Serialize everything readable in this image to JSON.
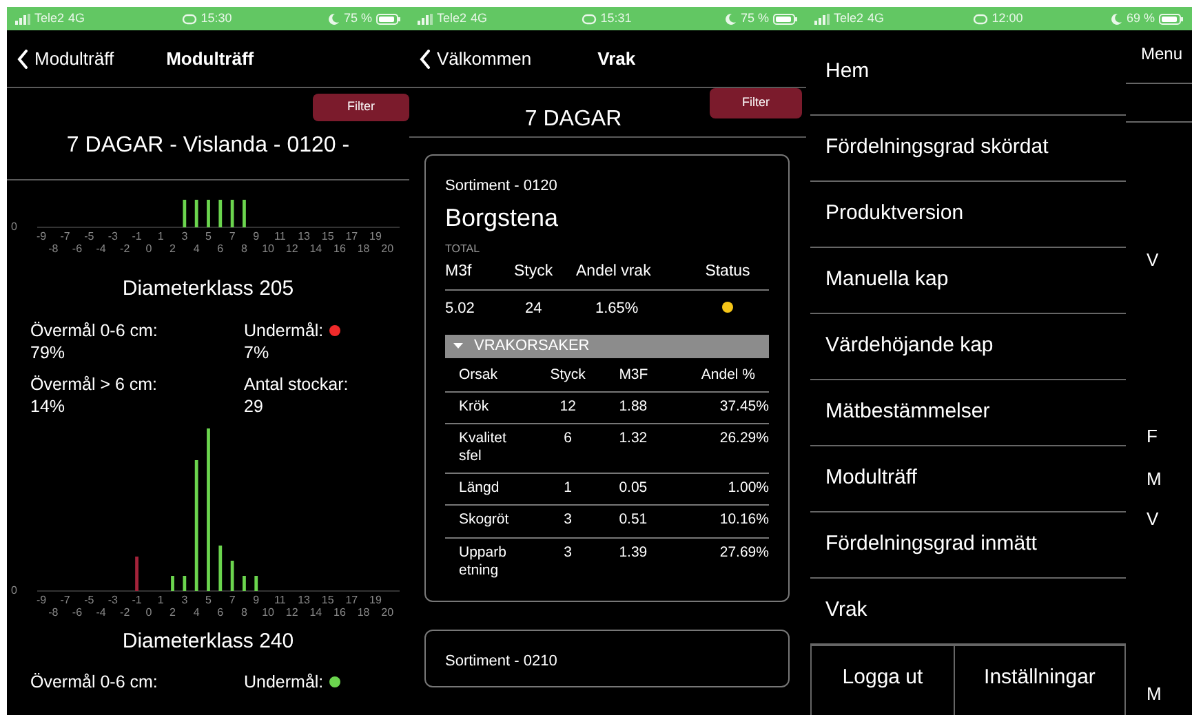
{
  "modultraff_screen": {
    "status_bar": {
      "carrier": "Tele2",
      "network": "4G",
      "time": "15:30",
      "battery": "75 %"
    },
    "nav": {
      "back": "Modulträff",
      "title": "Modulträff"
    },
    "filter_button": "Filter",
    "heading": "7 DAGAR - Vislanda - 0120 -",
    "classes": [
      {
        "chart": {
          "zero_label": "0",
          "x_labels": [
            "-9",
            "-8",
            "-7",
            "-6",
            "-5",
            "-4",
            "-3",
            "-2",
            "-1",
            "0",
            "1",
            "2",
            "3",
            "4",
            "5",
            "6",
            "7",
            "8",
            "9",
            "10",
            "11",
            "12",
            "13",
            "14",
            "15",
            "16",
            "17",
            "18",
            "19",
            "20"
          ]
        },
        "title": "Diameterklass 205",
        "stats": [
          {
            "label": "Övermål 0-6 cm:",
            "value": "79%"
          },
          {
            "label": "Undermål:",
            "value": "7%",
            "color": "#f02a2a"
          },
          {
            "label": "Övermål > 6 cm:",
            "value": "14%"
          },
          {
            "label": "Antal stockar:",
            "value": "29"
          }
        ]
      },
      {
        "chart": {
          "zero_label": "0",
          "x_labels": [
            "-9",
            "-8",
            "-7",
            "-6",
            "-5",
            "-4",
            "-3",
            "-2",
            "-1",
            "0",
            "1",
            "2",
            "3",
            "4",
            "5",
            "6",
            "7",
            "8",
            "9",
            "10",
            "11",
            "12",
            "13",
            "14",
            "15",
            "16",
            "17",
            "18",
            "19",
            "20"
          ]
        },
        "title": "Diameterklass 240",
        "stats": [
          {
            "label": "Övermål 0-6 cm:"
          },
          {
            "label": "Undermål:",
            "color": "#6bd54e"
          }
        ]
      }
    ]
  },
  "vrak_screen": {
    "status_bar": {
      "carrier": "Tele2",
      "network": "4G",
      "time": "15:31",
      "battery": "75 %"
    },
    "nav": {
      "back": "Välkommen",
      "title": "Vrak"
    },
    "filter_button": "Filter",
    "heading": "7 DAGAR",
    "cards": [
      {
        "subtitle": "Sortiment - 0120",
        "title": "Borgstena",
        "total_label": "TOTAL",
        "total_columns": [
          "M3f",
          "Styck",
          "Andel vrak",
          "Status"
        ],
        "total_row": {
          "m3f": "5.02",
          "styck": "24",
          "andel": "1.65%",
          "color": "#f5c518"
        },
        "section": {
          "label": "VRAKORSAKER",
          "expanded": true
        },
        "columns": [
          "Orsak",
          "Styck",
          "M3F",
          "Andel %"
        ],
        "rows": [
          [
            "Krök",
            "12",
            "1.88",
            "37.45%"
          ],
          [
            "Kvalitet sfel",
            "6",
            "1.32",
            "26.29%"
          ],
          [
            "Längd",
            "1",
            "0.05",
            "1.00%"
          ],
          [
            "Skogröt",
            "3",
            "0.51",
            "10.16%"
          ],
          [
            "Upparb etning",
            "3",
            "1.39",
            "27.69%"
          ]
        ]
      },
      {
        "subtitle": "Sortiment - 0210"
      }
    ]
  },
  "menu_screen": {
    "status_bar": {
      "carrier": "Tele2",
      "network": "4G",
      "time": "12:00",
      "battery": "69 %"
    },
    "items": [
      "Hem",
      "Fördelningsgrad skördat",
      "Produktversion",
      "Manuella kap",
      "Värdehöjande kap",
      "Mätbestämmelser",
      "Modulträff",
      "Fördelningsgrad inmätt",
      "Vrak"
    ],
    "buttons": [
      "Logga ut",
      "Inställningar"
    ],
    "background": {
      "title": "Menu",
      "fragments": [
        "V",
        "F",
        "M",
        "V",
        "M"
      ]
    }
  }
}
